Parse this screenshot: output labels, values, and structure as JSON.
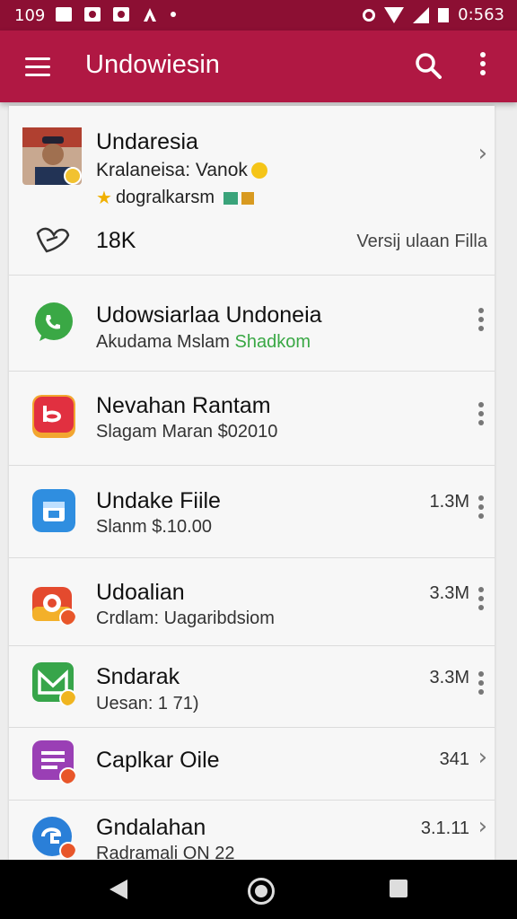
{
  "status_bar": {
    "time": "109",
    "clock": "0:563"
  },
  "app_bar": {
    "title": "Undowiesin"
  },
  "featured": {
    "title": "Undaresia",
    "subtitle1": "Kralaneisa: Vanok",
    "subtitle2": "dogralkarsm",
    "count": "18K",
    "version": "Versij ulaan Filla"
  },
  "items": [
    {
      "title": "Udowsiarlaa Undoneia",
      "subtitle": "Akudama Mslam",
      "highlight": "Shadkom",
      "size": ""
    },
    {
      "title": "Nevahan Rantam",
      "subtitle": "Slagam Maran $02010",
      "size": ""
    },
    {
      "title": "Undake Fiile",
      "subtitle": "Slanm $.10.00",
      "size": "1.3M"
    },
    {
      "title": "Udoalian",
      "subtitle": "Crdlam: Uagaribdsiom",
      "size": "3.3M"
    },
    {
      "title": "Sndarak",
      "subtitle": "Uesan: 1 71)",
      "size": "3.3M"
    },
    {
      "title": "Caplkar Oile",
      "subtitle": "",
      "size": "341"
    },
    {
      "title": "Gndalahan",
      "subtitle": "Radramali ON 22",
      "size": "3.1.11"
    }
  ],
  "colors": {
    "appbar": "#b01843",
    "statusbar": "#8c0f33"
  }
}
